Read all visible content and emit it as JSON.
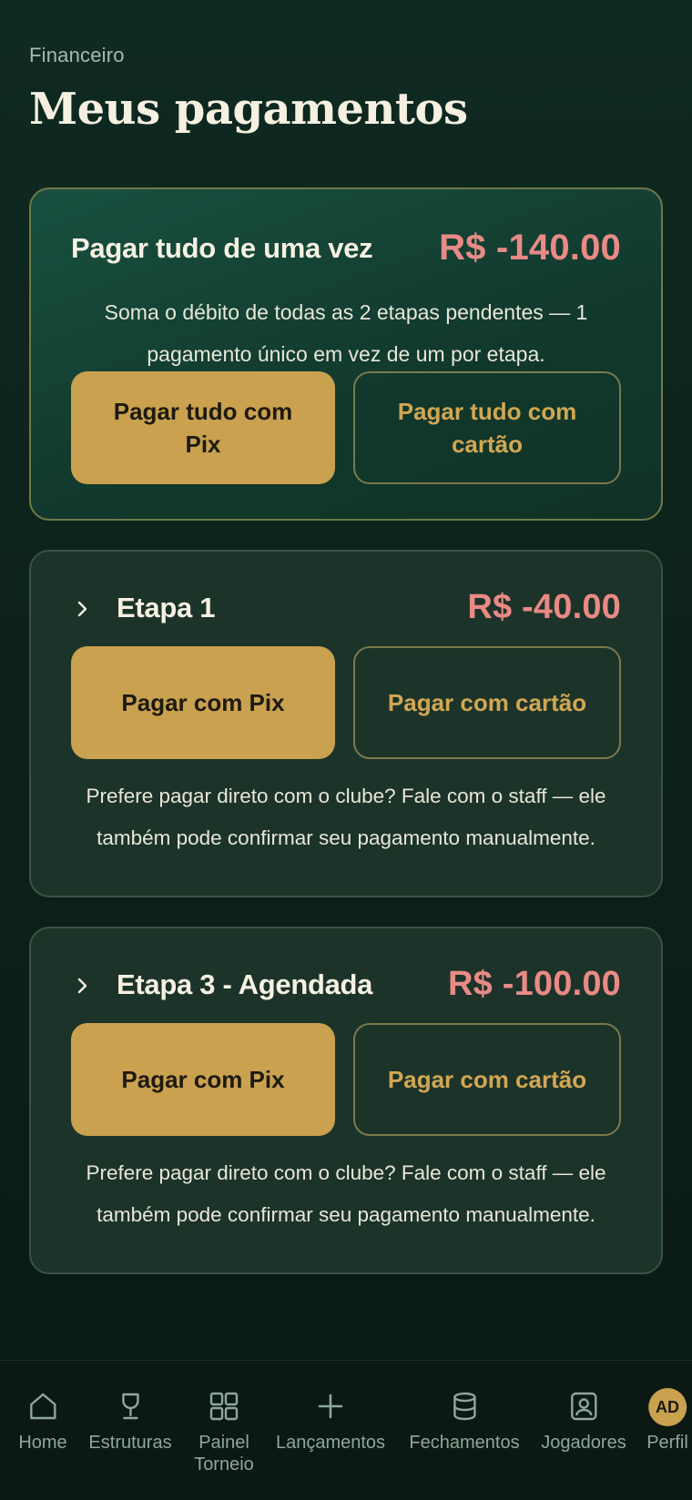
{
  "header": {
    "eyebrow": "Financeiro",
    "title": "Meus pagamentos"
  },
  "pay_all": {
    "title": "Pagar tudo de uma vez",
    "amount": "R$ -140.00",
    "description": "Soma o débito de todas as 2 etapas pendentes — 1 pagamento único em vez de um por etapa.",
    "pix_label": "Pagar tudo com Pix",
    "card_label": "Pagar tudo com cartão"
  },
  "stages": [
    {
      "title": "Etapa 1",
      "amount": "R$ -40.00",
      "pix_label": "Pagar com Pix",
      "card_label": "Pagar com cartão",
      "note": "Prefere pagar direto com o clube? Fale com o staff — ele também pode confirmar seu pagamento manualmente."
    },
    {
      "title": "Etapa 3 - Agendada",
      "amount": "R$ -100.00",
      "pix_label": "Pagar com Pix",
      "card_label": "Pagar com cartão",
      "note": "Prefere pagar direto com o clube? Fale com o staff — ele também pode confirmar seu pagamento manualmente."
    }
  ],
  "nav": {
    "items": [
      {
        "label": "Home",
        "icon": "home-icon"
      },
      {
        "label": "Estruturas",
        "icon": "trophy-icon"
      },
      {
        "label": "Painel Torneio",
        "icon": "grid-icon"
      },
      {
        "label": "Lançamentos",
        "icon": "plus-icon"
      },
      {
        "label": "Fechamentos",
        "icon": "database-icon"
      },
      {
        "label": "Jogadores",
        "icon": "user-card-icon"
      },
      {
        "label": "Perfil",
        "icon": "avatar",
        "initials": "AD"
      }
    ]
  },
  "colors": {
    "accent": "#c9a14f",
    "amount": "#e98a86",
    "background": "#0f2a22"
  }
}
